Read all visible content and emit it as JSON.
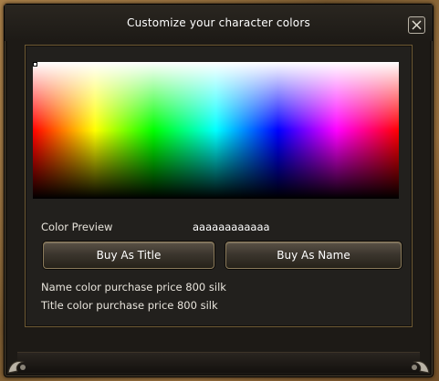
{
  "window": {
    "title": "Customize your character colors",
    "close_icon": "close-icon"
  },
  "color_picker": {
    "selected_color": "#ffffff"
  },
  "preview": {
    "label": "Color Preview",
    "text": "aaaaaaaaaaaa"
  },
  "buttons": {
    "buy_title": "Buy As Title",
    "buy_name": "Buy As Name"
  },
  "prices": {
    "name": "Name color purchase price 800 silk",
    "title": "Title color purchase price 800 silk"
  },
  "colors": {
    "accent_border": "#6e5a34",
    "panel_bg": "#22201d"
  }
}
